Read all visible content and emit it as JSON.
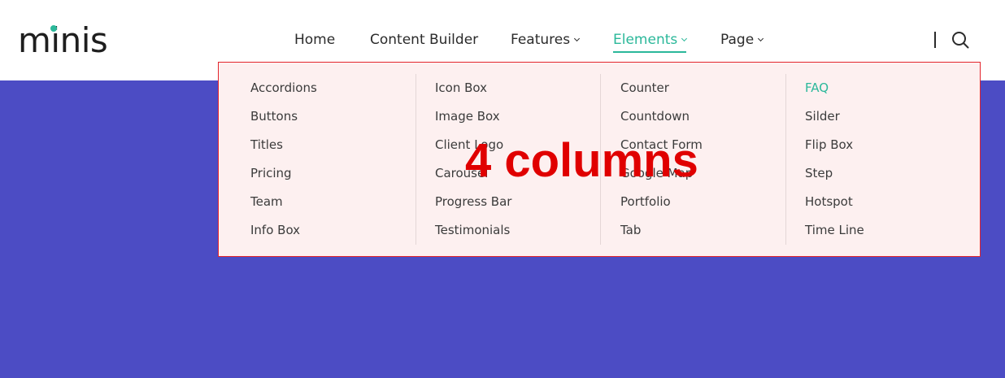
{
  "brand": {
    "name": "minis",
    "accent": "#2bb89a"
  },
  "nav": {
    "items": [
      {
        "label": "Home",
        "has_dropdown": false,
        "active": false
      },
      {
        "label": "Content Builder",
        "has_dropdown": false,
        "active": false
      },
      {
        "label": "Features",
        "has_dropdown": true,
        "active": false
      },
      {
        "label": "Elements",
        "has_dropdown": true,
        "active": true
      },
      {
        "label": "Page",
        "has_dropdown": true,
        "active": false
      }
    ]
  },
  "dropdown": {
    "columns": [
      [
        "Accordions",
        "Buttons",
        "Titles",
        "Pricing",
        "Team",
        "Info Box"
      ],
      [
        "Icon Box",
        "Image Box",
        "Client Logo",
        "Carousel",
        "Progress Bar",
        "Testimonials"
      ],
      [
        "Counter",
        "Countdown",
        "Contact Form",
        "Google Map",
        "Portfolio",
        "Tab"
      ],
      [
        "FAQ",
        "Silder",
        "Flip Box",
        "Step",
        "Hotspot",
        "Time Line"
      ]
    ],
    "active_item": "FAQ"
  },
  "annotation": {
    "text": "4 columns",
    "color": "#e00000"
  },
  "colors": {
    "page_background": "#4c4cc4",
    "dropdown_background": "#fdf0f0",
    "highlight_border": "#e3242b"
  }
}
